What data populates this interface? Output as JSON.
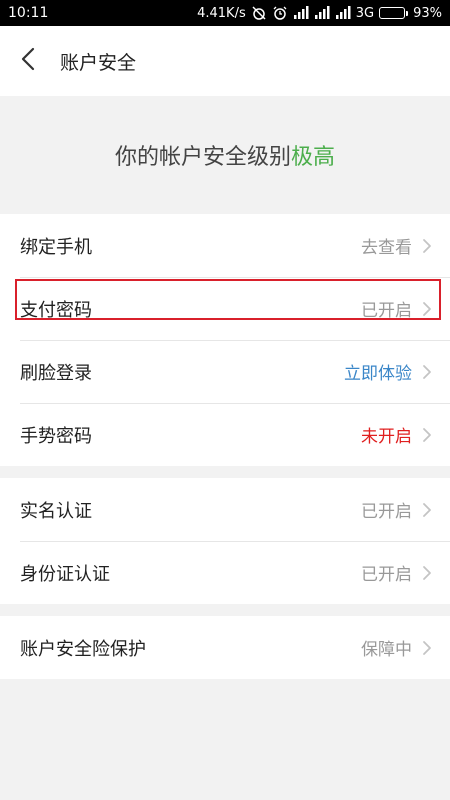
{
  "status_bar": {
    "time": "10:11",
    "network_speed": "4.41K/s",
    "network_type": "3G",
    "battery_percent": "93%",
    "battery_level": 0.93,
    "icons": [
      "alarm-off-icon",
      "alarm-clock-icon",
      "signal-icon",
      "signal-icon",
      "signal-icon",
      "battery-icon"
    ]
  },
  "nav": {
    "back_icon": "back-arrow-icon",
    "title": "账户安全"
  },
  "security_level": {
    "prefix": "你的帐户安全级别",
    "level": "极高",
    "level_color": "#4cae4c"
  },
  "groups": [
    {
      "rows": [
        {
          "label": "绑定手机",
          "value": "去查看",
          "value_color": "#999999"
        },
        {
          "label": "支付密码",
          "value": "已开启",
          "value_color": "#999999",
          "highlighted": true
        },
        {
          "label": "刷脸登录",
          "value": "立即体验",
          "value_color": "#3a86c8"
        },
        {
          "label": "手势密码",
          "value": "未开启",
          "value_color": "#e02020"
        }
      ]
    },
    {
      "rows": [
        {
          "label": "实名认证",
          "value": "已开启",
          "value_color": "#999999"
        },
        {
          "label": "身份证认证",
          "value": "已开启",
          "value_color": "#999999"
        }
      ]
    },
    {
      "rows": [
        {
          "label": "账户安全险保护",
          "value": "保障中",
          "value_color": "#999999"
        }
      ]
    }
  ],
  "colors": {
    "background": "#f2f2f2",
    "highlight_border": "#d9202b",
    "chevron": "#c4c4c4"
  }
}
